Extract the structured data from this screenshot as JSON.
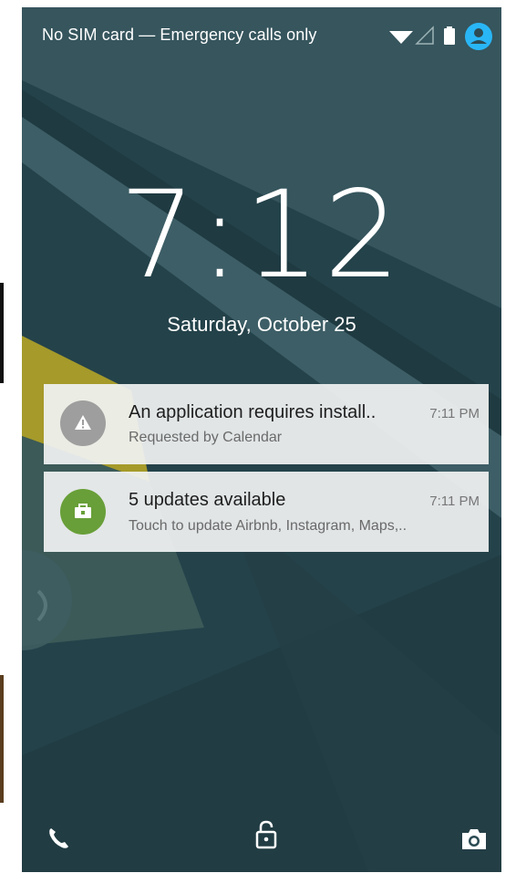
{
  "status_bar": {
    "carrier_text": "No SIM card — Emergency calls only",
    "icons": [
      "wifi-icon",
      "signal-icon",
      "battery-icon",
      "user-account-icon"
    ],
    "accent_color": "#29b6f6"
  },
  "lockscreen": {
    "time": "7:12",
    "date": "Saturday, October 25"
  },
  "notifications": [
    {
      "icon": "warning-icon",
      "icon_color": "#9e9e9e",
      "title": "An application requires install..",
      "subtitle": "Requested by Calendar",
      "time": "7:11 PM"
    },
    {
      "icon": "store-update-icon",
      "icon_color": "#689f38",
      "title": "5 updates available",
      "subtitle": "Touch to update Airbnb, Instagram, Maps,..",
      "time": "7:11 PM"
    }
  ],
  "bottom_actions": [
    "phone-icon",
    "unlock-icon",
    "camera-icon"
  ]
}
